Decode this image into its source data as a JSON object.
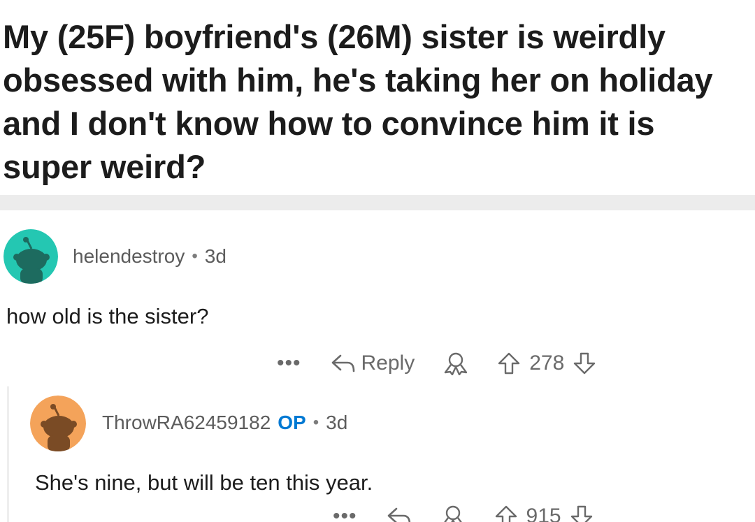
{
  "post": {
    "title": "My (25F) boyfriend's (26M) sister is weirdly obsessed with him, he's taking her on holiday and I don't know how to convince him it is super weird?"
  },
  "comments": [
    {
      "username": "helendestroy",
      "age": "3d",
      "body": "how old is the sister?",
      "actions": {
        "more": "•••",
        "reply_label": "Reply",
        "score": "278"
      },
      "avatar_color": "#24c7b2"
    },
    {
      "username": "ThrowRA62459182",
      "op_badge": "OP",
      "age": "3d",
      "body": "She's nine, but will be ten this year.",
      "actions": {
        "more": "•••",
        "score": "915"
      },
      "avatar_color": "#f4a35a"
    }
  ],
  "separator": "•",
  "icons": {
    "reply": "reply-arrow-icon",
    "award": "award-icon",
    "upvote": "upvote-arrow-icon",
    "downvote": "downvote-arrow-icon"
  },
  "colors": {
    "op_badge": "#0079d3",
    "meta_text": "#5c5c5c",
    "divider": "#ececec"
  }
}
